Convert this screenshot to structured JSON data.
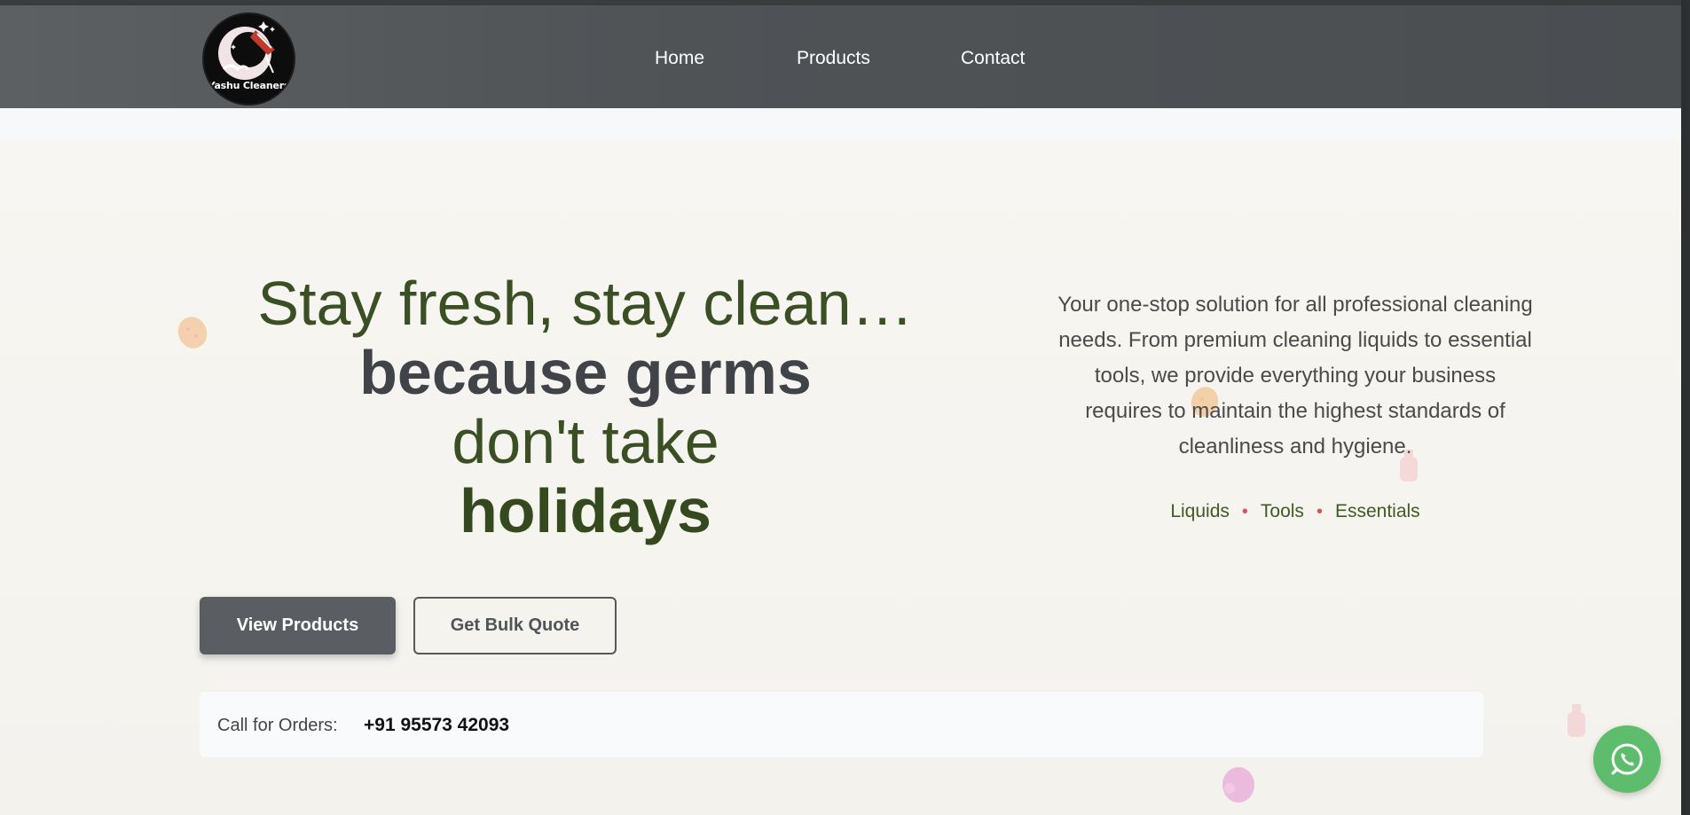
{
  "brand": {
    "logo_text": "Yashu Cleaners"
  },
  "nav": {
    "items": [
      {
        "label": "Home"
      },
      {
        "label": "Products"
      },
      {
        "label": "Contact"
      }
    ]
  },
  "hero": {
    "headline": {
      "line1": "Stay fresh, stay clean…",
      "line2": "because germs",
      "line3": "don't take",
      "line4": "holidays"
    },
    "description": "Your one-stop solution for all professional cleaning needs. From premium cleaning liquids to essential tools, we provide everything your business requires to maintain the highest standards of cleanliness and hygiene.",
    "tags": [
      "Liquids",
      "Tools",
      "Essentials"
    ],
    "tag_separator": "•",
    "primary_button": "View Products",
    "secondary_button": "Get Bulk Quote"
  },
  "contact": {
    "call_label": "Call for Orders:",
    "phone": "+91 95573 42093"
  },
  "floating": {
    "icon": "whatsapp-icon"
  },
  "colors": {
    "nav_background": "#4f5356",
    "headline_green": "#3a4f24",
    "headline_gray": "#404347",
    "tag_dot": "#d9534f",
    "whatsapp_green": "#5ebd6d"
  }
}
